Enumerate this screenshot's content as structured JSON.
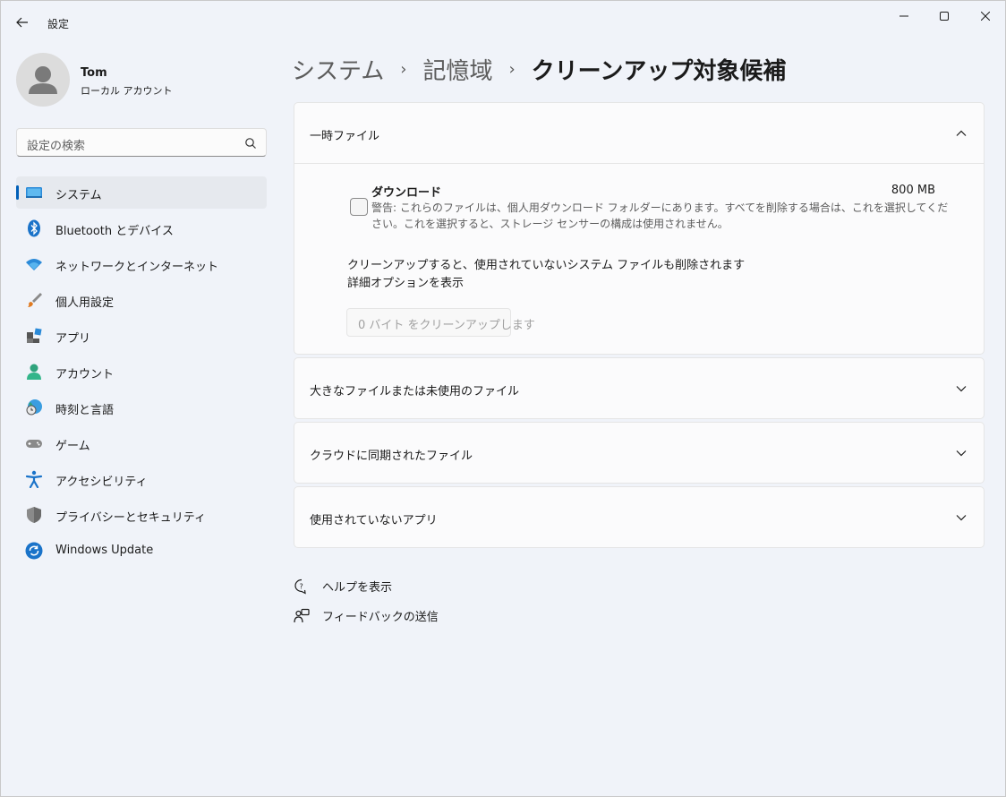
{
  "app": {
    "title": "設定",
    "back_icon": "arrow-left-icon",
    "window_controls": [
      "minimize-icon",
      "maximize-icon",
      "close-icon"
    ]
  },
  "profile": {
    "name": "Tom",
    "account_type": "ローカル アカウント"
  },
  "search": {
    "placeholder": "設定の検索",
    "icon": "search-icon"
  },
  "sidebar": {
    "items": [
      {
        "label": "システム",
        "icon": "system-icon",
        "active": true
      },
      {
        "label": "Bluetooth とデバイス",
        "icon": "bluetooth-icon"
      },
      {
        "label": "ネットワークとインターネット",
        "icon": "wifi-icon"
      },
      {
        "label": "個人用設定",
        "icon": "brush-icon"
      },
      {
        "label": "アプリ",
        "icon": "apps-icon"
      },
      {
        "label": "アカウント",
        "icon": "account-icon"
      },
      {
        "label": "時刻と言語",
        "icon": "time-language-icon"
      },
      {
        "label": "ゲーム",
        "icon": "gamepad-icon"
      },
      {
        "label": "アクセシビリティ",
        "icon": "accessibility-icon"
      },
      {
        "label": "プライバシーとセキュリティ",
        "icon": "shield-icon"
      },
      {
        "label": "Windows Update",
        "icon": "update-icon"
      }
    ],
    "accent": "#005fb8"
  },
  "breadcrumb": {
    "items": [
      "システム",
      "記憶域",
      "クリーンアップ対象候補"
    ],
    "separator": "›"
  },
  "sections": {
    "temp": {
      "title": "一時ファイル",
      "expanded": true,
      "download": {
        "title": "ダウンロード",
        "size": "800 MB",
        "checked": false,
        "description": "警告: これらのファイルは、個人用ダウンロード フォルダーにあります。すべてを削除する場合は、これを選択してください。これを選択すると、ストレージ センサーの構成は使用されません。"
      },
      "cleanup_note": "クリーンアップすると、使用されていないシステム ファイルも削除されます",
      "advanced_link": "詳細オプションを表示",
      "cleanup_button": "0 バイト をクリーンアップします"
    },
    "large": {
      "title": "大きなファイルまたは未使用のファイル"
    },
    "cloud": {
      "title": "クラウドに同期されたファイル"
    },
    "unused_apps": {
      "title": "使用されていないアプリ"
    }
  },
  "links": {
    "help": "ヘルプを表示",
    "feedback": "フィードバックの送信"
  }
}
